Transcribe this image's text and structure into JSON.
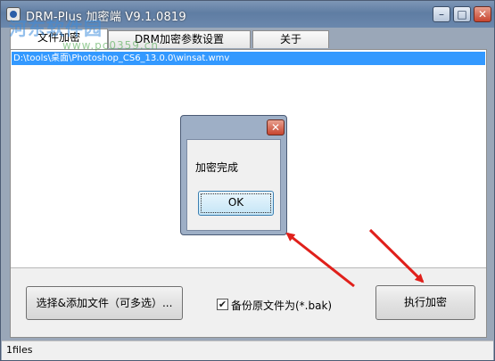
{
  "window": {
    "title": "DRM-Plus 加密端 V9.1.0819",
    "controls": {
      "minimize": "–",
      "maximize": "□",
      "close": "✕"
    }
  },
  "tabs": [
    {
      "label": "文件加密"
    },
    {
      "label": "DRM加密参数设置"
    },
    {
      "label": "关于"
    }
  ],
  "file_list": {
    "rows": [
      "D:\\tools\\桌面\\Photoshop_CS6_13.0.0\\winsat.wmv"
    ]
  },
  "buttons": {
    "add_files": "选择&添加文件（可多选）...",
    "encrypt": "执行加密"
  },
  "backup_option": {
    "checked": true,
    "check_mark": "✔",
    "label": "备份原文件为(*.bak)"
  },
  "status": {
    "text": "1files"
  },
  "dialog": {
    "close": "✕",
    "message": "加密完成",
    "ok": "OK"
  },
  "watermark": {
    "text": "河东软件园",
    "url": "www.pc0359.cn"
  },
  "colors": {
    "selection": "#3399ff",
    "arrow": "#e0201b"
  }
}
